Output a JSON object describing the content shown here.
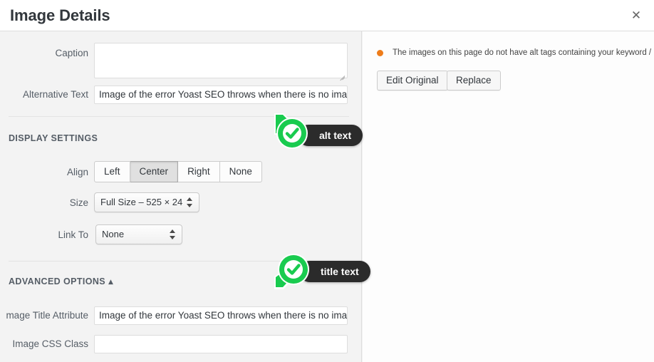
{
  "header": {
    "title": "Image Details",
    "close_icon": "close-icon"
  },
  "form": {
    "caption": {
      "label": "Caption",
      "value": ""
    },
    "alt_text": {
      "label": "Alternative Text",
      "value": "Image of the error Yoast SEO throws when there is no image "
    },
    "display_settings_heading": "DISPLAY SETTINGS",
    "align": {
      "label": "Align",
      "options": [
        "Left",
        "Center",
        "Right",
        "None"
      ],
      "selected": "Center"
    },
    "size": {
      "label": "Size",
      "value": "Full Size – 525 × 24"
    },
    "link_to": {
      "label": "Link To",
      "value": "None"
    },
    "advanced_heading": "ADVANCED OPTIONS",
    "advanced_toggle_icon": "▲",
    "image_title_attribute": {
      "label": "mage Title Attribute",
      "value": "Image of the error Yoast SEO throws when there is no image "
    },
    "image_css_class": {
      "label": "Image CSS Class",
      "value": ""
    }
  },
  "sidebar": {
    "warning": "The images on this page do not have alt tags containing your keyword / phrase.",
    "bullet_icon": "orange-dot-icon",
    "bullet_color": "#ee7c1a",
    "edit_original_label": "Edit Original",
    "replace_label": "Replace"
  },
  "annotations": [
    {
      "label": "alt text",
      "icon": "green-check-pin-icon",
      "color": "#19cb4f"
    },
    {
      "label": "title text",
      "icon": "green-check-pin-icon",
      "color": "#19cb4f"
    }
  ]
}
